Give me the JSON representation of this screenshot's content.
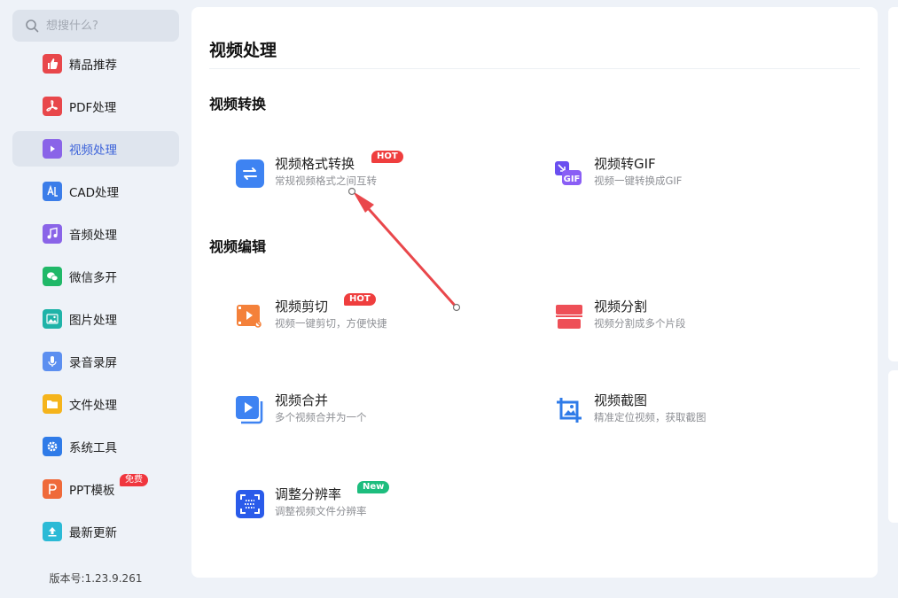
{
  "search": {
    "placeholder": "想搜什么?"
  },
  "sidebar": {
    "items": [
      {
        "label": "精品推荐",
        "icon": "thumbs-up-icon",
        "color": "#e8474b"
      },
      {
        "label": "PDF处理",
        "icon": "pdf-icon",
        "color": "#e8474b"
      },
      {
        "label": "视频处理",
        "icon": "play-icon",
        "color": "#8a64e8"
      },
      {
        "label": "CAD处理",
        "icon": "cad-icon",
        "color": "#3b7de9"
      },
      {
        "label": "音频处理",
        "icon": "music-icon",
        "color": "#8a64e8"
      },
      {
        "label": "微信多开",
        "icon": "wechat-icon",
        "color": "#20b868"
      },
      {
        "label": "图片处理",
        "icon": "image-icon",
        "color": "#1fb3a8"
      },
      {
        "label": "录音录屏",
        "icon": "microphone-icon",
        "color": "#5c8ff0"
      },
      {
        "label": "文件处理",
        "icon": "folder-icon",
        "color": "#f5b41c"
      },
      {
        "label": "系统工具",
        "icon": "gear-icon",
        "color": "#2f7be8"
      },
      {
        "label": "PPT模板",
        "icon": "ppt-icon",
        "color": "#ef6a3a",
        "badge": "免费"
      },
      {
        "label": "最新更新",
        "icon": "upload-icon",
        "color": "#2bbad6"
      }
    ],
    "active_index": 2,
    "version": "版本号:1.23.9.261"
  },
  "main": {
    "title": "视频处理",
    "sections": [
      {
        "title": "视频转换",
        "tools": [
          {
            "name": "视频格式转换",
            "desc": "常规视频格式之间互转",
            "tag": "HOT",
            "icon": "convert-arrows-icon"
          },
          {
            "name": "视频转GIF",
            "desc": "视频一键转换成GIF",
            "icon": "gif-icon"
          }
        ]
      },
      {
        "title": "视频编辑",
        "tools": [
          {
            "name": "视频剪切",
            "desc": "视频一键剪切，方便快捷",
            "tag": "HOT",
            "icon": "video-cut-icon"
          },
          {
            "name": "视频分割",
            "desc": "视频分割成多个片段",
            "icon": "video-split-icon"
          },
          {
            "name": "视频合并",
            "desc": "多个视频合并为一个",
            "icon": "video-merge-icon"
          },
          {
            "name": "视频截图",
            "desc": "精准定位视频，获取截图",
            "icon": "crop-image-icon"
          },
          {
            "name": "调整分辨率",
            "desc": "调整视频文件分辨率",
            "tag": "New",
            "icon": "resolution-icon"
          }
        ]
      }
    ]
  },
  "colors": {
    "accent": "#3d63d9",
    "hot": "#ef3e3e",
    "new": "#1dbd7e",
    "annotation_arrow": "#e9474b"
  }
}
